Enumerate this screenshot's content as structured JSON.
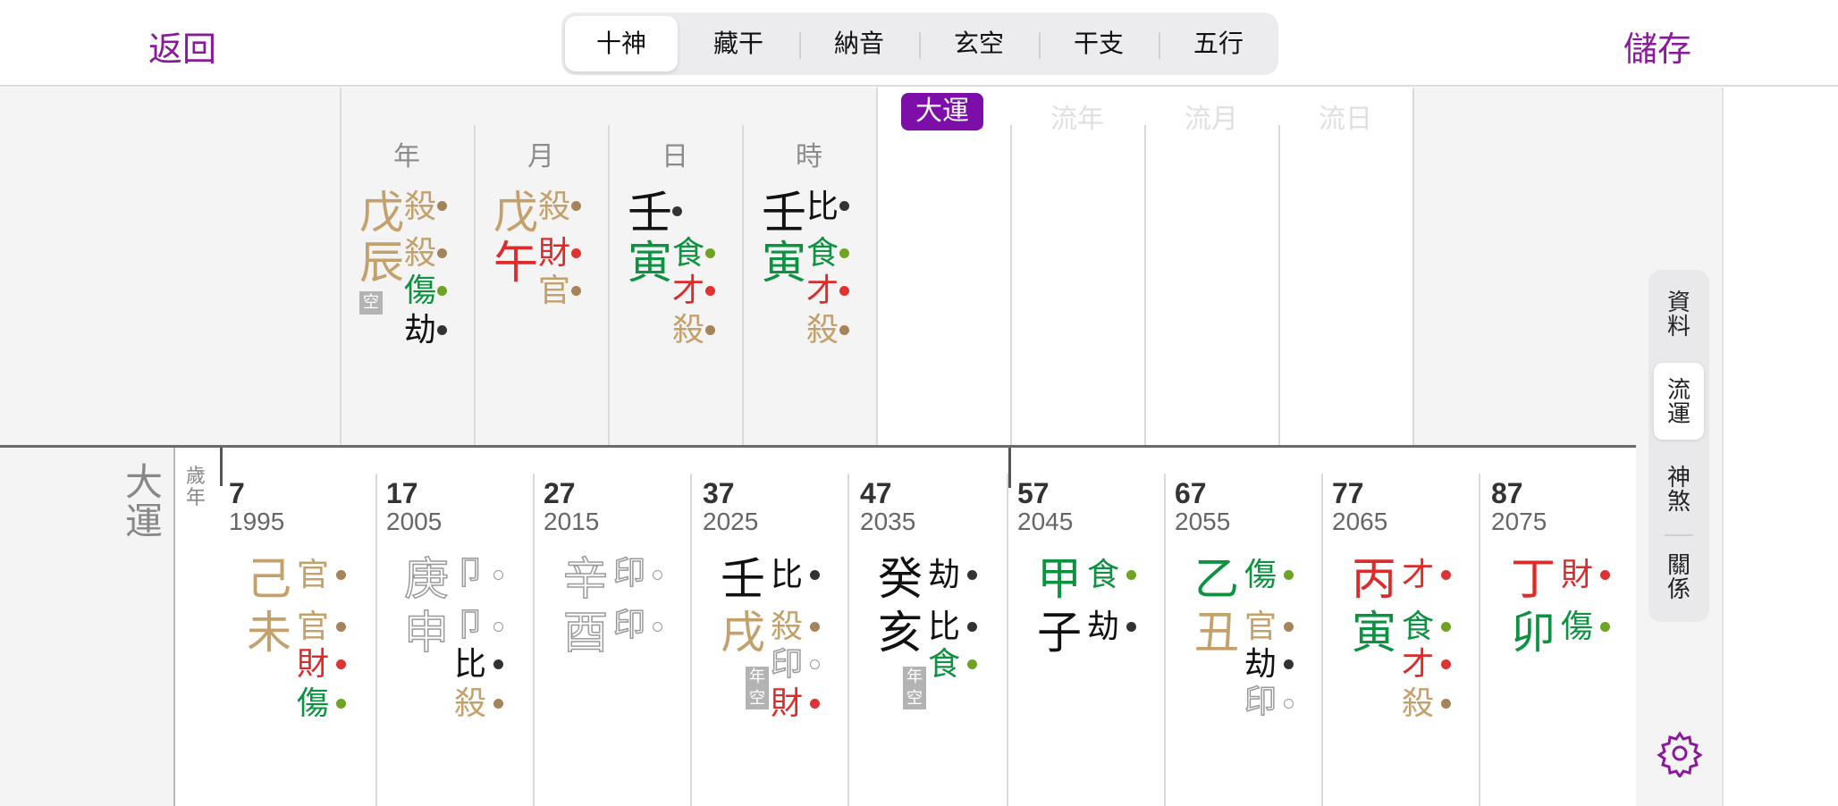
{
  "header": {
    "back_label": "返回",
    "save_label": "儲存",
    "tabs": [
      "十神",
      "藏干",
      "納音",
      "玄空",
      "干支",
      "五行"
    ],
    "active_tab": "十神"
  },
  "pillars": {
    "headers": [
      "年",
      "月",
      "日",
      "時"
    ],
    "flow_headers": [
      "大運",
      "流年",
      "流月",
      "流日"
    ],
    "active_flow": "大運",
    "empty_tag": "空",
    "year": {
      "stem": "戊",
      "branch": "辰",
      "stem_god": "殺",
      "branch_gods": [
        "殺",
        "傷",
        "劫"
      ]
    },
    "month": {
      "stem": "戊",
      "branch": "午",
      "stem_god": "殺",
      "branch_gods": [
        "財",
        "官"
      ]
    },
    "day": {
      "stem": "壬",
      "branch": "寅",
      "stem_god": "",
      "branch_gods": [
        "食",
        "才",
        "殺"
      ]
    },
    "hour": {
      "stem": "壬",
      "branch": "寅",
      "stem_god": "比",
      "branch_gods": [
        "食",
        "才",
        "殺"
      ]
    }
  },
  "dayun": {
    "label": "大運",
    "sub_label": "歲年",
    "year_empty_tag": "年空",
    "columns": [
      {
        "age": "7",
        "year": "1995",
        "stem": "己",
        "branch": "未",
        "stem_god": "官",
        "branch_gods": [
          "官",
          "財",
          "傷"
        ]
      },
      {
        "age": "17",
        "year": "2005",
        "stem": "庚",
        "branch": "申",
        "stem_god": "卩",
        "branch_gods": [
          "卩",
          "比",
          "殺"
        ]
      },
      {
        "age": "27",
        "year": "2015",
        "stem": "辛",
        "branch": "酉",
        "stem_god": "印",
        "branch_gods": [
          "印"
        ]
      },
      {
        "age": "37",
        "year": "2025",
        "stem": "壬",
        "branch": "戌",
        "stem_god": "比",
        "branch_gods": [
          "殺",
          "印",
          "財"
        ]
      },
      {
        "age": "47",
        "year": "2035",
        "stem": "癸",
        "branch": "亥",
        "stem_god": "劫",
        "branch_gods": [
          "比",
          "食"
        ]
      },
      {
        "age": "57",
        "year": "2045",
        "stem": "甲",
        "branch": "子",
        "stem_god": "食",
        "branch_gods": [
          "劫"
        ]
      },
      {
        "age": "67",
        "year": "2055",
        "stem": "乙",
        "branch": "丑",
        "stem_god": "傷",
        "branch_gods": [
          "官",
          "劫",
          "印"
        ]
      },
      {
        "age": "77",
        "year": "2065",
        "stem": "丙",
        "branch": "寅",
        "stem_god": "才",
        "branch_gods": [
          "食",
          "才",
          "殺"
        ]
      },
      {
        "age": "87",
        "year": "2075",
        "stem": "丁",
        "branch": "卯",
        "stem_god": "財",
        "branch_gods": [
          "傷"
        ]
      }
    ]
  },
  "side_tabs": [
    "資料",
    "流運",
    "神煞",
    "關係"
  ],
  "active_side_tab": "流運",
  "icons": {
    "settings": "gear-icon"
  },
  "colors": {
    "accent": "#8a1a9b",
    "earth": "#c4a06b",
    "fire": "#dd2b2b",
    "wood": "#0c9240",
    "water": "#111111",
    "metal_outline": "#9a9a9a",
    "dot_earth": "#a5835b",
    "dot_fire": "#dd3333",
    "dot_wood": "#6fa324",
    "dot_water": "#333333",
    "tag_gray": "#b3b3b3"
  }
}
